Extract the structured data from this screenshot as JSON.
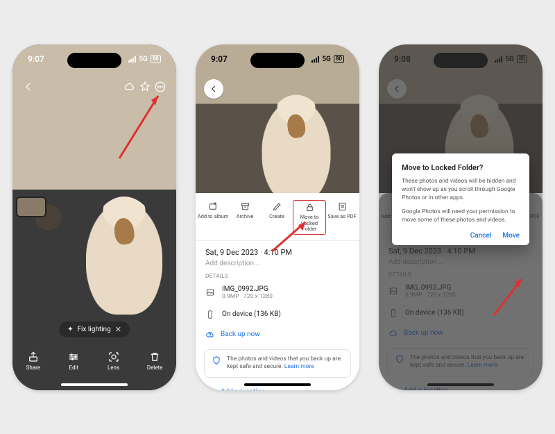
{
  "phones": [
    {
      "status": {
        "time": "9:07",
        "network": "5G",
        "battery": "80"
      },
      "suggestion": {
        "icon": "sparkle-icon",
        "label": "Fix lighting"
      },
      "bottom": [
        {
          "icon": "share-icon",
          "label": "Share"
        },
        {
          "icon": "sliders-icon",
          "label": "Edit"
        },
        {
          "icon": "lens-icon",
          "label": "Lens"
        },
        {
          "icon": "trash-icon",
          "label": "Delete"
        }
      ]
    },
    {
      "status": {
        "time": "9:07",
        "network": "5G",
        "battery": "80"
      },
      "actions": [
        {
          "icon": "add-album-icon",
          "label": "Add to album"
        },
        {
          "icon": "archive-icon",
          "label": "Archive"
        },
        {
          "icon": "pencil-icon",
          "label": "Create"
        },
        {
          "icon": "lock-icon",
          "label": "Move to Locked Folder",
          "highlight": true
        },
        {
          "icon": "pdf-icon",
          "label": "Save as PDF"
        }
      ],
      "meta": {
        "date": "Sat, 9 Dec 2023",
        "time": "4:10 PM",
        "placeholder": "Add description..."
      },
      "details_header": "DETAILS",
      "details": [
        {
          "icon": "image-icon",
          "main": "IMG_0992.JPG",
          "sub": "0.9MP  ·  720 x 1280"
        },
        {
          "icon": "phone-icon",
          "main": "On device (136 KB)",
          "sub": ""
        }
      ],
      "backup": {
        "label": "Back up now"
      },
      "info_card": {
        "text": "The photos and videos that you back up are kept safe and secure.",
        "link": "Learn more"
      },
      "location": {
        "label": "Add a location"
      }
    },
    {
      "status": {
        "time": "9:08",
        "network": "5G",
        "battery": "80"
      },
      "dialog": {
        "title": "Move to Locked Folder?",
        "body1": "These photos and videos will be hidden and won't show up as you scroll through Google Photos or in other apps.",
        "body2": "Google Photos will need your permission to move some of these photos and videos.",
        "cancel": "Cancel",
        "confirm": "Move"
      }
    }
  ]
}
